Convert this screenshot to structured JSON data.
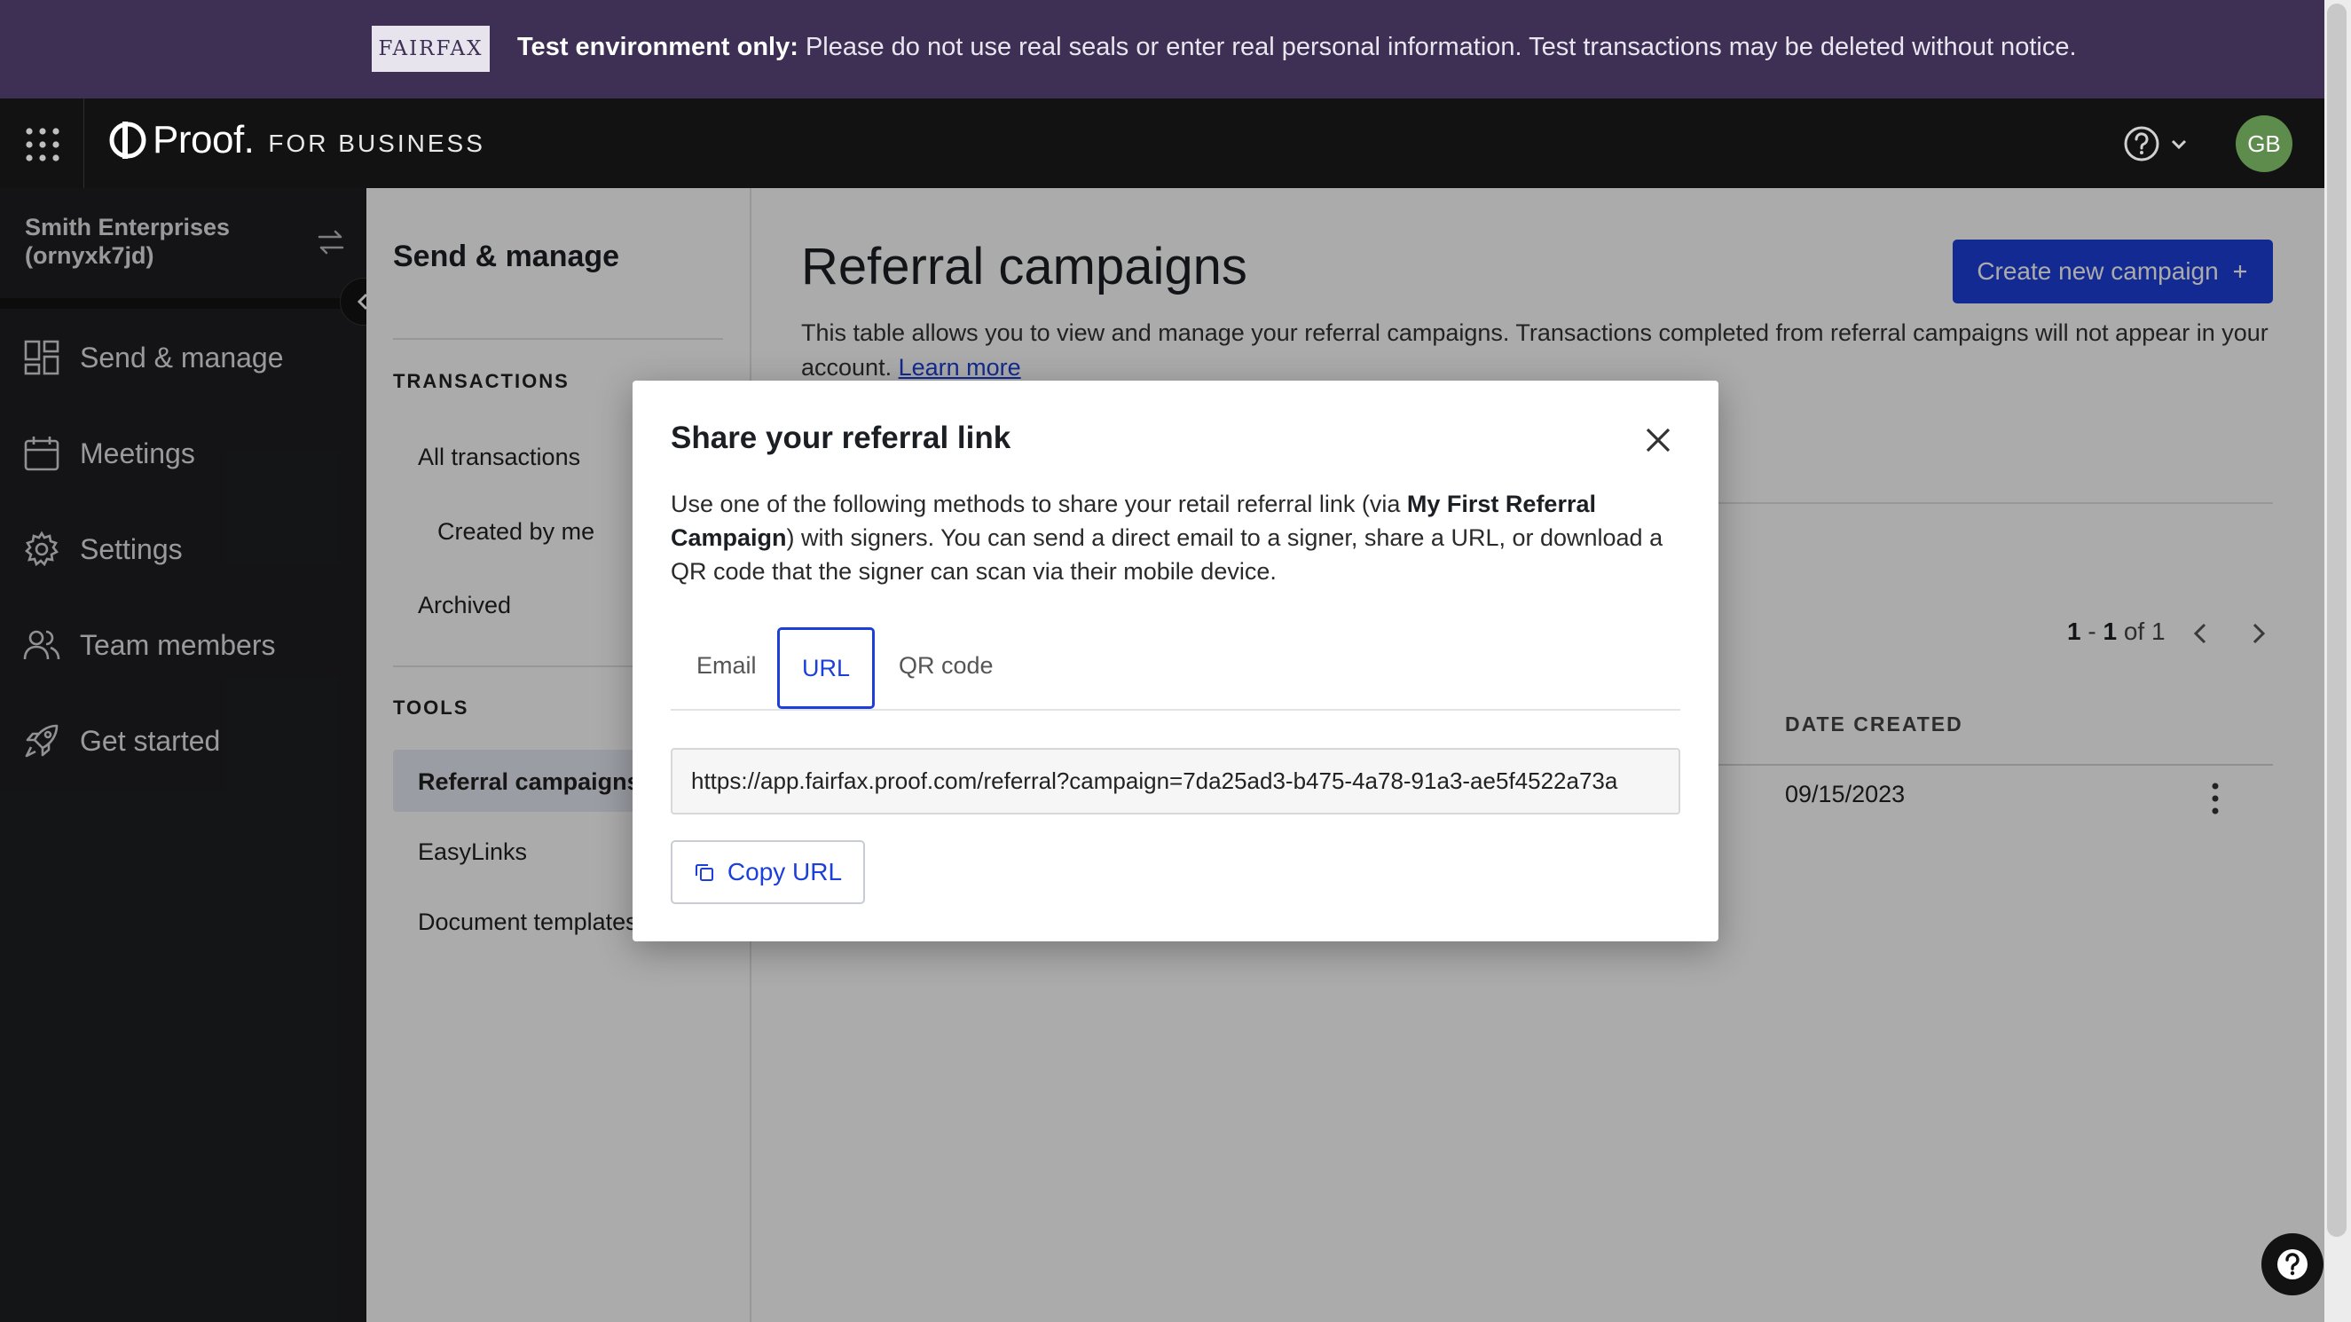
{
  "banner": {
    "logo_text": "FAIRFAX",
    "strong": "Test environment only:",
    "message": " Please do not use real seals or enter real personal information. Test transactions may be deleted without notice."
  },
  "topbar": {
    "brand": "Proof.",
    "brand_sub": "FOR BUSINESS",
    "avatar_initials": "GB"
  },
  "sidebar": {
    "org_name": "Smith Enterprises (ornyxk7jd)",
    "items": [
      {
        "label": "Send & manage",
        "icon": "dashboard-icon"
      },
      {
        "label": "Meetings",
        "icon": "calendar-icon"
      },
      {
        "label": "Settings",
        "icon": "gear-icon"
      },
      {
        "label": "Team members",
        "icon": "team-icon"
      },
      {
        "label": "Get started",
        "icon": "rocket-icon"
      }
    ]
  },
  "subnav": {
    "title": "Send & manage",
    "transactions_heading": "TRANSACTIONS",
    "all_transactions": "All transactions",
    "created_by_me": "Created by me",
    "archived": "Archived",
    "tools_heading": "TOOLS",
    "referral_campaigns": "Referral campaigns",
    "easylinks": "EasyLinks",
    "document_templates": "Document templates"
  },
  "main": {
    "title": "Referral campaigns",
    "create_button": "Create new campaign",
    "description": "This table allows you to view and manage your referral campaigns. Transactions completed from referral campaigns will not appear in your account.",
    "learn_more": "Learn more",
    "pager": {
      "start": "1",
      "end": "1",
      "total": "1"
    },
    "column_date_created": "DATE CREATED",
    "rows": [
      {
        "date_created": "09/15/2023"
      }
    ]
  },
  "modal": {
    "title": "Share your referral link",
    "desc_prefix": "Use one of the following methods to share your retail referral link (via ",
    "campaign_name": "My First Referral Campaign",
    "desc_suffix": ") with signers. You can send a direct email to a signer, share a URL, or download a QR code that the signer can scan via their mobile device.",
    "tabs": [
      "Email",
      "URL",
      "QR code"
    ],
    "active_tab": "URL",
    "url": "https://app.fairfax.proof.com/referral?campaign=7da25ad3-b475-4a78-91a3-ae5f4522a73a",
    "copy_button": "Copy URL"
  },
  "colors": {
    "banner_bg": "#3d3054",
    "topbar_bg": "#121212",
    "sidebar_bg": "#1e1f21",
    "accent": "#1b3fd8",
    "avatar_bg": "#5d8c4c"
  }
}
